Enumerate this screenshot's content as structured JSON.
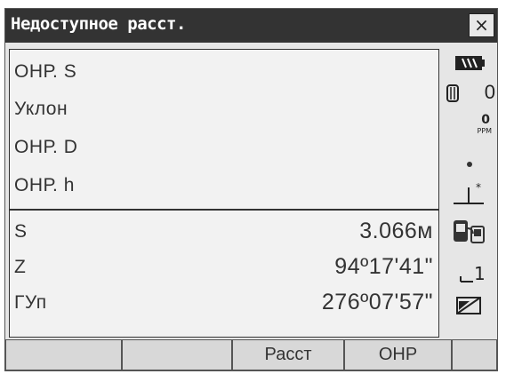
{
  "window": {
    "title": "Недоступное расст.",
    "close_label": "×"
  },
  "fields": {
    "top": [
      "ОНР. S",
      "Уклон",
      "ОНР. D",
      "ОНР. h"
    ],
    "measurements": [
      {
        "label": "S",
        "value": "3.066м"
      },
      {
        "label": "Z",
        "value": "94º17'41\""
      },
      {
        "label": "ГУп",
        "value": "276º07'57\""
      }
    ]
  },
  "status": {
    "prism_constant": "0",
    "ppm_value": "0",
    "ppm_unit": "PPM"
  },
  "softkeys": [
    "",
    "",
    "Расст",
    "ОНР",
    ""
  ]
}
